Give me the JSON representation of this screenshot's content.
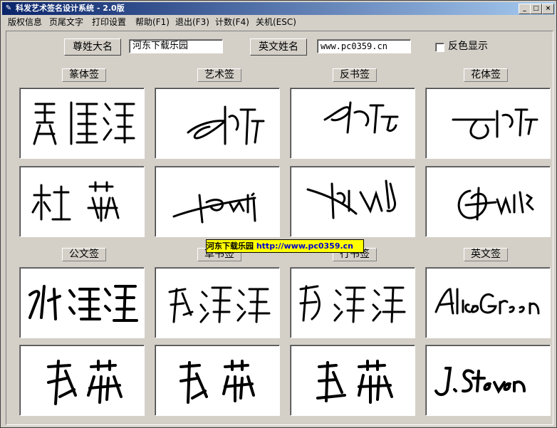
{
  "window": {
    "title": "科发艺术签名设计系统 - 2.0版",
    "icon": "app-icon",
    "buttons": [
      "minimize",
      "maximize",
      "close"
    ]
  },
  "menu": [
    {
      "label": "版权信息"
    },
    {
      "label": "页尾文字"
    },
    {
      "label": "打印设置"
    },
    {
      "label": "帮助(F1)"
    },
    {
      "label": "退出(F3)"
    },
    {
      "label": "计数(F4)"
    },
    {
      "label": "关机(ESC)"
    }
  ],
  "form": {
    "chinese_name_label": "尊姓大名",
    "chinese_name_value": "河东下载乐园",
    "english_name_label": "英文姓名",
    "english_name_value": "www.pc0359.cn",
    "invert_label": "反色显示",
    "invert_checked": false
  },
  "groups": [
    {
      "label": "篆体签",
      "samples": [
        {
          "content": "handwritten-signature"
        },
        {
          "content": "handwritten-signature"
        }
      ]
    },
    {
      "label": "艺术签",
      "samples": [
        {
          "content": "handwritten-signature"
        },
        {
          "content": "handwritten-signature"
        }
      ]
    },
    {
      "label": "反书签",
      "samples": [
        {
          "content": "handwritten-signature"
        },
        {
          "content": "handwritten-signature"
        }
      ]
    },
    {
      "label": "花体签",
      "samples": [
        {
          "content": "handwritten-signature"
        },
        {
          "content": "handwritten-signature"
        }
      ]
    },
    {
      "label": "公文签",
      "samples": [
        {
          "content": "handwritten-signature"
        },
        {
          "content": "handwritten-signature"
        }
      ]
    },
    {
      "label": "草书签",
      "samples": [
        {
          "content": "handwritten-signature"
        },
        {
          "content": "handwritten-signature"
        }
      ]
    },
    {
      "label": "行书签",
      "samples": [
        {
          "content": "handwritten-signature"
        },
        {
          "content": "handwritten-signature"
        }
      ]
    },
    {
      "label": "英文签",
      "samples": [
        {
          "content": "handwritten-signature"
        },
        {
          "content": "handwritten-signature"
        }
      ]
    }
  ],
  "watermark": {
    "text": "河东下载乐园",
    "url": "http://www.pc0359.cn",
    "background": "#ffff00"
  },
  "colors": {
    "title_start": "#0a246a",
    "title_end": "#a6caf0",
    "face": "#d4d0c8"
  }
}
